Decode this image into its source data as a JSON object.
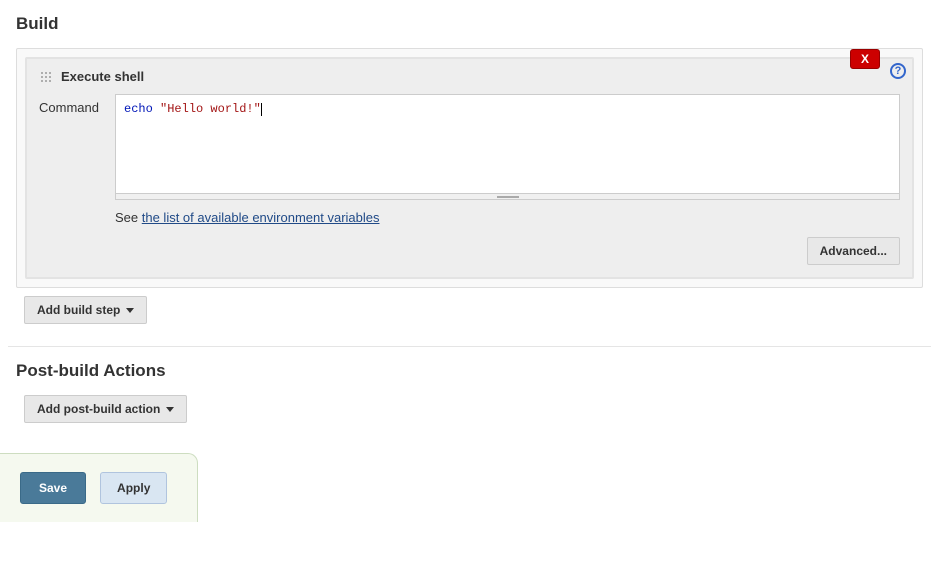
{
  "sections": {
    "build_title": "Build",
    "post_build_title": "Post-build Actions"
  },
  "build_step": {
    "title": "Execute shell",
    "delete_label": "X",
    "command_label": "Command",
    "command_tokens": {
      "keyword": "echo",
      "string": "\"Hello world!\""
    },
    "hint_prefix": "See ",
    "hint_link": "the list of available environment variables",
    "advanced_label": "Advanced..."
  },
  "buttons": {
    "add_build_step": "Add build step",
    "add_post_build_action": "Add post-build action",
    "save": "Save",
    "apply": "Apply"
  }
}
